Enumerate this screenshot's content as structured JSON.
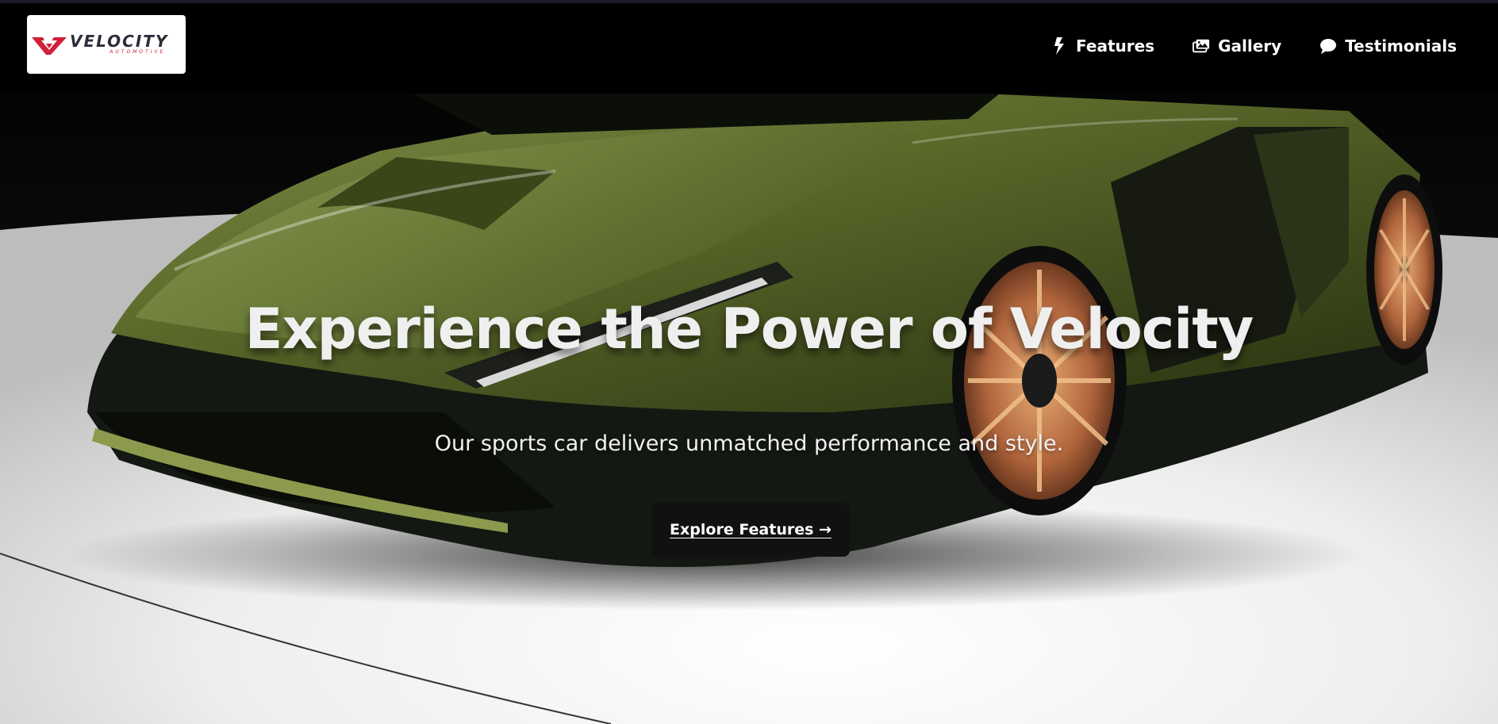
{
  "brand": {
    "name": "VELOCITY",
    "tagline": "AUTOMOTIVE",
    "logo_icon": "velocity-v-logo-icon",
    "accent_color": "#d0203a"
  },
  "nav": {
    "items": [
      {
        "label": "Features",
        "icon": "lightning-icon"
      },
      {
        "label": "Gallery",
        "icon": "gallery-icon"
      },
      {
        "label": "Testimonials",
        "icon": "chat-bubble-icon"
      }
    ]
  },
  "hero": {
    "title": "Experience the Power of Velocity",
    "subtitle": "Our sports car delivers unmatched performance and style.",
    "cta_label": "Explore Features →",
    "background_image": "green supercar on white studio floor",
    "car_color": "#5c6b2e",
    "wheel_color": "#c97a4a"
  }
}
